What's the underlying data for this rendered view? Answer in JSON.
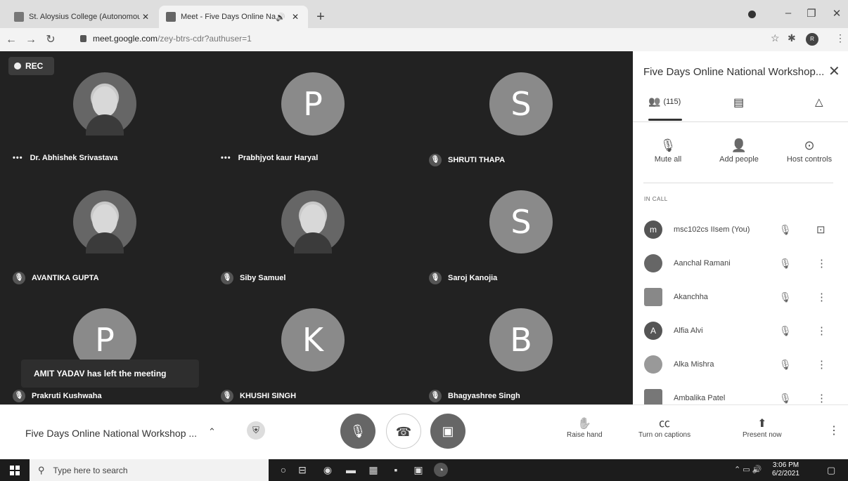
{
  "browser": {
    "tabs": [
      {
        "title": "St. Aloysius College (Autonomou",
        "active": false
      },
      {
        "title": "Meet - Five Days Online Nat",
        "active": true
      }
    ],
    "url_host": "meet.google.com",
    "url_path": "/zey-btrs-cdr?authuser=1",
    "profile_initial": "R"
  },
  "recording": {
    "label": "REC"
  },
  "tiles": [
    {
      "name": "Dr. Abhishek Srivastava",
      "initial": "",
      "photo": true,
      "status": "more"
    },
    {
      "name": "Prabhjyot kaur Haryal",
      "initial": "P",
      "photo": false,
      "status": "more"
    },
    {
      "name": "SHRUTI THAPA",
      "initial": "S",
      "photo": false,
      "status": "muted"
    },
    {
      "name": "AVANTIKA GUPTA",
      "initial": "",
      "photo": true,
      "status": "muted"
    },
    {
      "name": "Siby Samuel",
      "initial": "",
      "photo": true,
      "status": "muted"
    },
    {
      "name": "Saroj Kanojia",
      "initial": "S",
      "photo": false,
      "status": "muted"
    },
    {
      "name": "Prakruti Kushwaha",
      "initial": "P",
      "photo": false,
      "status": "muted"
    },
    {
      "name": "KHUSHI SINGH",
      "initial": "K",
      "photo": false,
      "status": "muted"
    },
    {
      "name": "Bhagyashree Singh",
      "initial": "B",
      "photo": false,
      "status": "muted"
    }
  ],
  "toast": "AMIT YADAV has left the meeting",
  "panel": {
    "title": "Five Days Online National Workshop...",
    "people_count": "(115)",
    "actions": [
      {
        "label": "Mute all",
        "icon": "mic-off-icon",
        "glyph": "🎙"
      },
      {
        "label": "Add people",
        "icon": "person-add-icon",
        "glyph": "👤"
      },
      {
        "label": "Host controls",
        "icon": "toggle-icon",
        "glyph": "⊙"
      }
    ],
    "section_label": "IN CALL",
    "participants": [
      {
        "name": "msc102cs IIsem (You)",
        "initial": "m",
        "action": "pin"
      },
      {
        "name": "Aanchal Ramani",
        "initial": "",
        "action": "menu"
      },
      {
        "name": "Akanchha",
        "initial": "",
        "action": "menu"
      },
      {
        "name": "Alfia Alvi",
        "initial": "A",
        "action": "menu"
      },
      {
        "name": "Alka Mishra",
        "initial": "",
        "action": "menu"
      },
      {
        "name": "Ambalika Patel",
        "initial": "",
        "action": "menu"
      }
    ]
  },
  "controls": {
    "meeting_title": "Five Days Online National Workshop ...",
    "raise_hand": "Raise hand",
    "captions": "Turn on captions",
    "present": "Present now"
  },
  "taskbar": {
    "search_placeholder": "Type here to search",
    "time": "3:06 PM",
    "date": "6/2/2021"
  }
}
